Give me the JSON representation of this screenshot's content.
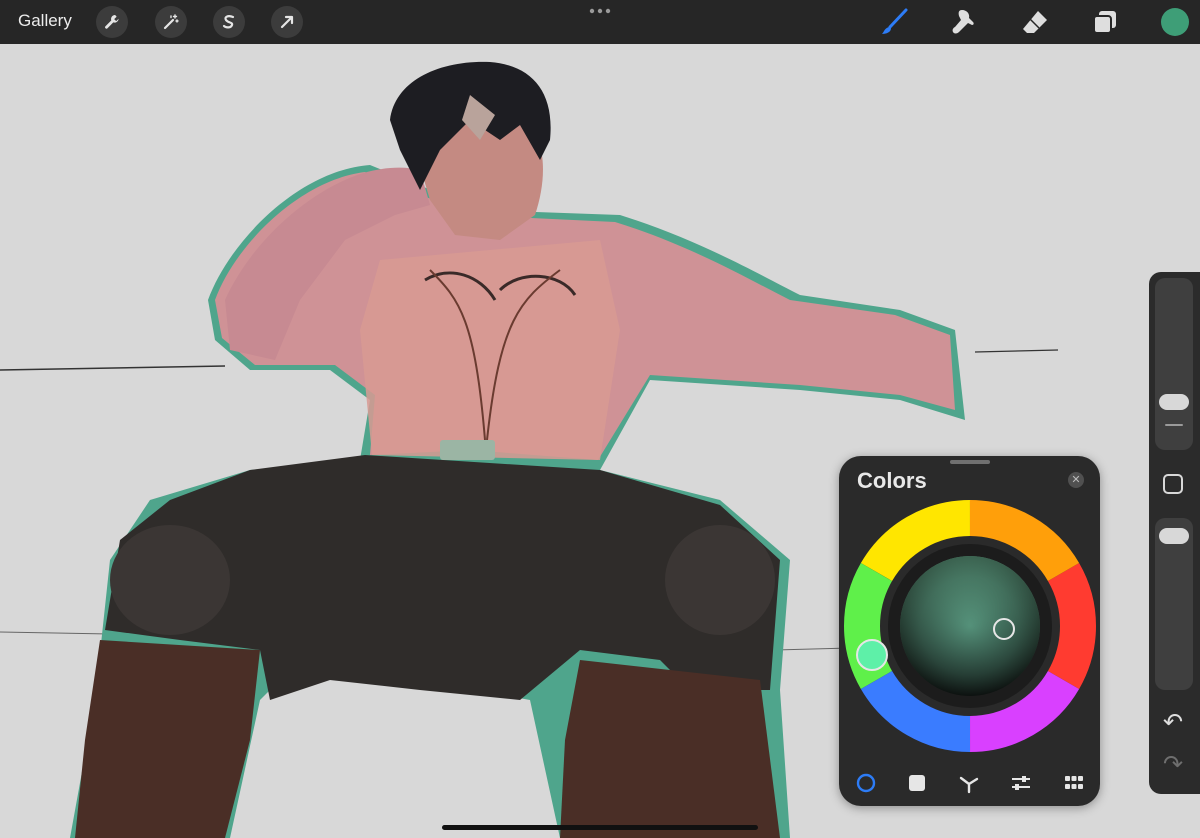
{
  "topbar": {
    "gallery_label": "Gallery",
    "left_tools": [
      "wrench-icon",
      "magic-wand-icon",
      "selection-s-icon",
      "transform-arrow-icon"
    ],
    "right_tools": [
      "brush-icon",
      "smudge-icon",
      "eraser-icon",
      "layers-icon"
    ],
    "brush_active_color": "#2d7cf6",
    "current_color": "#3e9e77"
  },
  "colors_panel": {
    "title": "Colors",
    "close_label": "✕",
    "tabs": [
      "disc-tab",
      "classic-tab",
      "harmony-tab",
      "value-tab",
      "palettes-tab"
    ],
    "active_tab": "disc-tab",
    "selected_hue_color": "#5ef0a8",
    "accent": "#2d7cf6"
  },
  "sidebar": {
    "undo_label": "↶",
    "redo_label": "↷"
  }
}
